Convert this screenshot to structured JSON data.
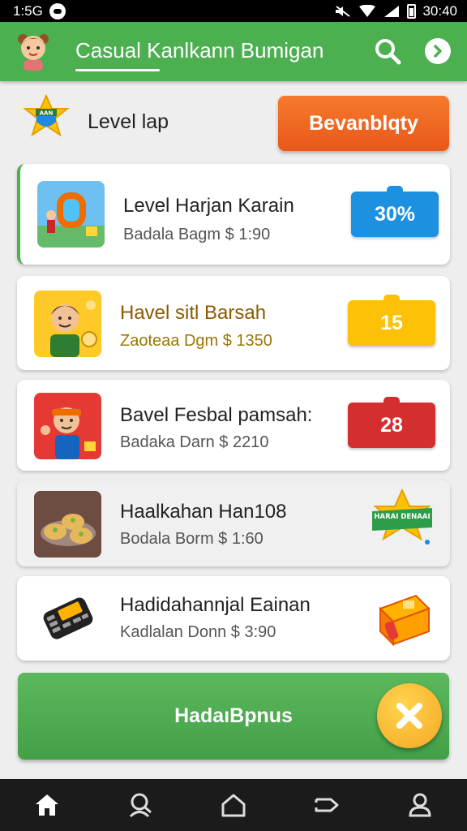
{
  "status_bar": {
    "time_left": "1:5G",
    "time_right": "30:40"
  },
  "app_bar": {
    "title": "Casual Kanlkann Bumigan"
  },
  "level_row": {
    "label": "Level lap",
    "action_label": "Bevanblqty",
    "badge_text": "AAN"
  },
  "cards": [
    {
      "title": "Level Harjan Karain",
      "subtitle": "Badala Bagm $ 1:90",
      "badge": "30%",
      "badge_color": "#1e90e0"
    },
    {
      "title": "Havel sitl Barsah",
      "subtitle": "Zaoteaa Dgm $ 1350",
      "badge": "15",
      "badge_color": "#ffc107"
    },
    {
      "title": "Bavel Fesbal pamsah:",
      "subtitle": "Badaka Darn $ 2210",
      "badge": "28",
      "badge_color": "#d32f2f"
    },
    {
      "title": "Haalkahan Han108",
      "subtitle": "Bodala Borm $ 1:60",
      "badge": "HARAI DENAAI"
    },
    {
      "title": "Hadidahannjal Eainan",
      "subtitle": "Kadlalan Donn $ 3:90"
    }
  ],
  "bonus_button": {
    "label": "HadaıBpnus"
  },
  "colors": {
    "primary": "#4caf50",
    "accent": "#f26a21",
    "fab": "#f5a623"
  },
  "icons": [
    "avatar-icon",
    "search-icon",
    "chevron-right-icon",
    "level-star-icon",
    "close-icon",
    "home-icon",
    "profile-search-icon",
    "house-outline-icon",
    "share-icon",
    "user-icon"
  ]
}
